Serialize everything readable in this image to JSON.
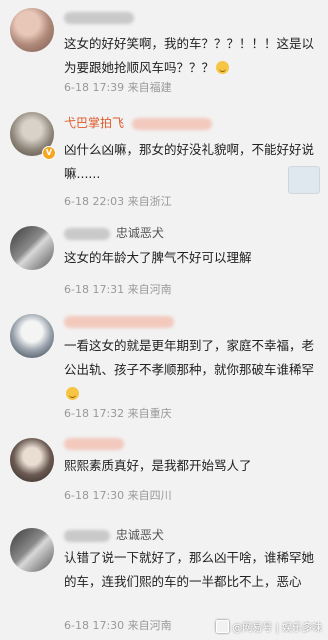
{
  "comments": [
    {
      "username": "",
      "text": "这女的好好笑啊，我的车？？？！！！这是以为要跟她抢顺风车吗？？？",
      "time": "6-18 17:39",
      "location": "来自福建"
    },
    {
      "username": "弋巴掌拍飞",
      "text": "凶什么凶嘛，那女的好没礼貌啊，不能好好说嘛......",
      "time": "6-18 22:03",
      "location": "来自浙江"
    },
    {
      "username": "忠诚恶犬",
      "text": "这女的年龄大了脾气不好可以理解",
      "time": "6-18 17:31",
      "location": "来自河南"
    },
    {
      "username": "",
      "text": "一看这女的就是更年期到了，家庭不幸福，老公出轨、孩子不孝顺那种，就你那破车谁稀罕",
      "time": "6-18 17:32",
      "location": "来自重庆"
    },
    {
      "username": "",
      "text": "熙熙素质真好，是我都开始骂人了",
      "time": "6-18 17:30",
      "location": "来自四川"
    },
    {
      "username": "忠诚恶犬",
      "text": "认错了说一下就好了，那么凶干啥，谁稀罕她的车，连我们熙的车的一半都比不上，恶心",
      "time": "6-18 17:30",
      "location": "来自河南"
    }
  ],
  "watermark": {
    "text": "@网易号 | 娱乐多味"
  },
  "colors": {
    "background": "#f2f2f2",
    "text": "#222222",
    "meta": "#999999"
  }
}
